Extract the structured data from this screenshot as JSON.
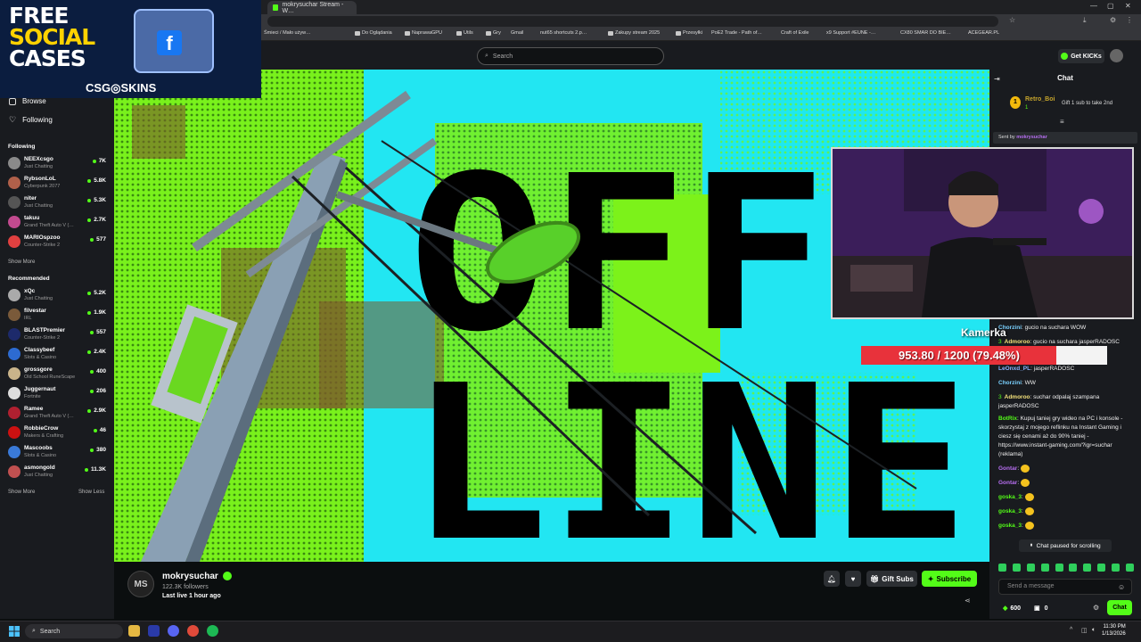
{
  "browser": {
    "active_tab": "mokrysuchar Stream - W…",
    "bookmarks": [
      "Śmieci / Mało używ…",
      "Do Oglądania",
      "NaprawaGPU",
      "Utils",
      "Gry",
      "Gmail",
      "nut65 shortcuts 2.p…",
      "Zakupy stream 2025",
      "Przesyłki",
      "PoE2 Trade - Path of…",
      "Craft of Exile",
      "x9 Support #EUNE -…",
      "CX80 SMAR DO BIE…",
      "ACEGEAR.PL"
    ]
  },
  "ad": {
    "line1": "FREE",
    "line2": "SOCIAL",
    "line3": "CASES",
    "brand": "CSG◎SKINS",
    "fb_letter": "f"
  },
  "header": {
    "search_placeholder": "Search",
    "get_kicks": "Get KICKs"
  },
  "sidebar": {
    "nav": [
      {
        "label": "Browse"
      },
      {
        "label": "Following"
      }
    ],
    "following_title": "Following",
    "following": [
      {
        "name": "NEEXcsgo",
        "category": "Just Chatting",
        "viewers": "7K",
        "color": "#8a8a8a"
      },
      {
        "name": "RybsonLoL",
        "category": "Cyberpunk 2077",
        "viewers": "5.8K",
        "color": "#b0604a"
      },
      {
        "name": "niter",
        "category": "Just Chatting",
        "viewers": "5.3K",
        "color": "#555"
      },
      {
        "name": "takuu",
        "category": "Grand Theft Auto V (…",
        "viewers": "2.7K",
        "color": "#c24a8f"
      },
      {
        "name": "MARIOspzoo",
        "category": "Counter-Strike 2",
        "viewers": "577",
        "color": "#e04040"
      }
    ],
    "show_more": "Show More",
    "recommended_title": "Recommended",
    "recommended": [
      {
        "name": "xQc",
        "category": "Just Chatting",
        "viewers": "5.2K",
        "color": "#aaa"
      },
      {
        "name": "filvestar",
        "category": "IRL",
        "viewers": "1.9K",
        "color": "#7a5a3a"
      },
      {
        "name": "BLASTPremier",
        "category": "Counter-Strike 2",
        "viewers": "557",
        "color": "#1d2a6b"
      },
      {
        "name": "Classybeef",
        "category": "Slots & Casino",
        "viewers": "2.4K",
        "color": "#2d6bd1"
      },
      {
        "name": "grossgore",
        "category": "Old School RuneScape",
        "viewers": "400",
        "color": "#c9b48a"
      },
      {
        "name": "Juggernaut",
        "category": "Fortnite",
        "viewers": "206",
        "color": "#ddd"
      },
      {
        "name": "Ramee",
        "category": "Grand Theft Auto V (…",
        "viewers": "2.9K",
        "color": "#b02030"
      },
      {
        "name": "RobbieCrow",
        "category": "Makers & Crafting",
        "viewers": "46",
        "color": "#cc1111"
      },
      {
        "name": "Mascoobs",
        "category": "Slots & Casino",
        "viewers": "380",
        "color": "#3a7ad8"
      },
      {
        "name": "asmongold",
        "category": "Just Chatting",
        "viewers": "11.3K",
        "color": "#c05050"
      }
    ],
    "show_more_2": "Show More",
    "show_less": "Show Less"
  },
  "video": {
    "offline_line1": "OFF",
    "offline_line2": "LINE"
  },
  "channel": {
    "initials": "MS",
    "name": "mokrysuchar",
    "followers": "122.3K followers",
    "last_live": "Last live 1 hour ago",
    "gift_subs": "Gift Subs",
    "subscribe": "Subscribe"
  },
  "chat": {
    "title": "Chat",
    "pinned": {
      "rank": "1",
      "user": "Retro_Boi",
      "sub": "1",
      "gift_text": "Gift 1 sub to take 2nd"
    },
    "sent_by_label": "Sent by",
    "sent_by_user": "mokrysuchar",
    "cam_label": "Kamerka",
    "goal": {
      "text": "953.80 / 1200 (79.48%)",
      "current": 953.8,
      "target": 1200
    },
    "messages": [
      {
        "user": "Chorzini",
        "color": "#7ad1ff",
        "text": "gucio na suchara WOW"
      },
      {
        "user": "Admoroo",
        "color": "#f2e07a",
        "text": "gucio na suchara jasperRADOSC",
        "prefix": "3"
      },
      {
        "user": "LeOnxd_PL",
        "color": "#8ab4ff",
        "text": "jasperRADOSC"
      },
      {
        "user": "Chorzini",
        "color": "#7ad1ff",
        "text": "WW"
      },
      {
        "user": "Admoroo",
        "color": "#f2e07a",
        "text": "suchar odpalaj szampana jasperRADOSC",
        "prefix": "3"
      },
      {
        "user": "BotRix",
        "color": "#53fc18",
        "text": "Kupuj taniej gry wideo na PC i konsole - skorzystaj z mojego reflinku na Instant Gaming i ciesz się cenami aż do 90% taniej - https://www.instant-gaming.com/?igr=suchar (reklama)"
      },
      {
        "user": "Gontar",
        "color": "#b66ef0",
        "text": ""
      },
      {
        "user": "Gontar",
        "color": "#b66ef0",
        "text": ""
      },
      {
        "user": "goska_3",
        "color": "#53fc18",
        "text": ""
      },
      {
        "user": "goska_3",
        "color": "#53fc18",
        "text": ""
      },
      {
        "user": "goska_3",
        "color": "#53fc18",
        "text": ""
      }
    ],
    "paused": "Chat paused for scrolling",
    "input_placeholder": "Send a message",
    "points": "600",
    "bag": "0",
    "chat_button": "Chat"
  },
  "taskbar": {
    "search": "Search",
    "time": "11:30 PM",
    "date": "1/13/2026"
  }
}
